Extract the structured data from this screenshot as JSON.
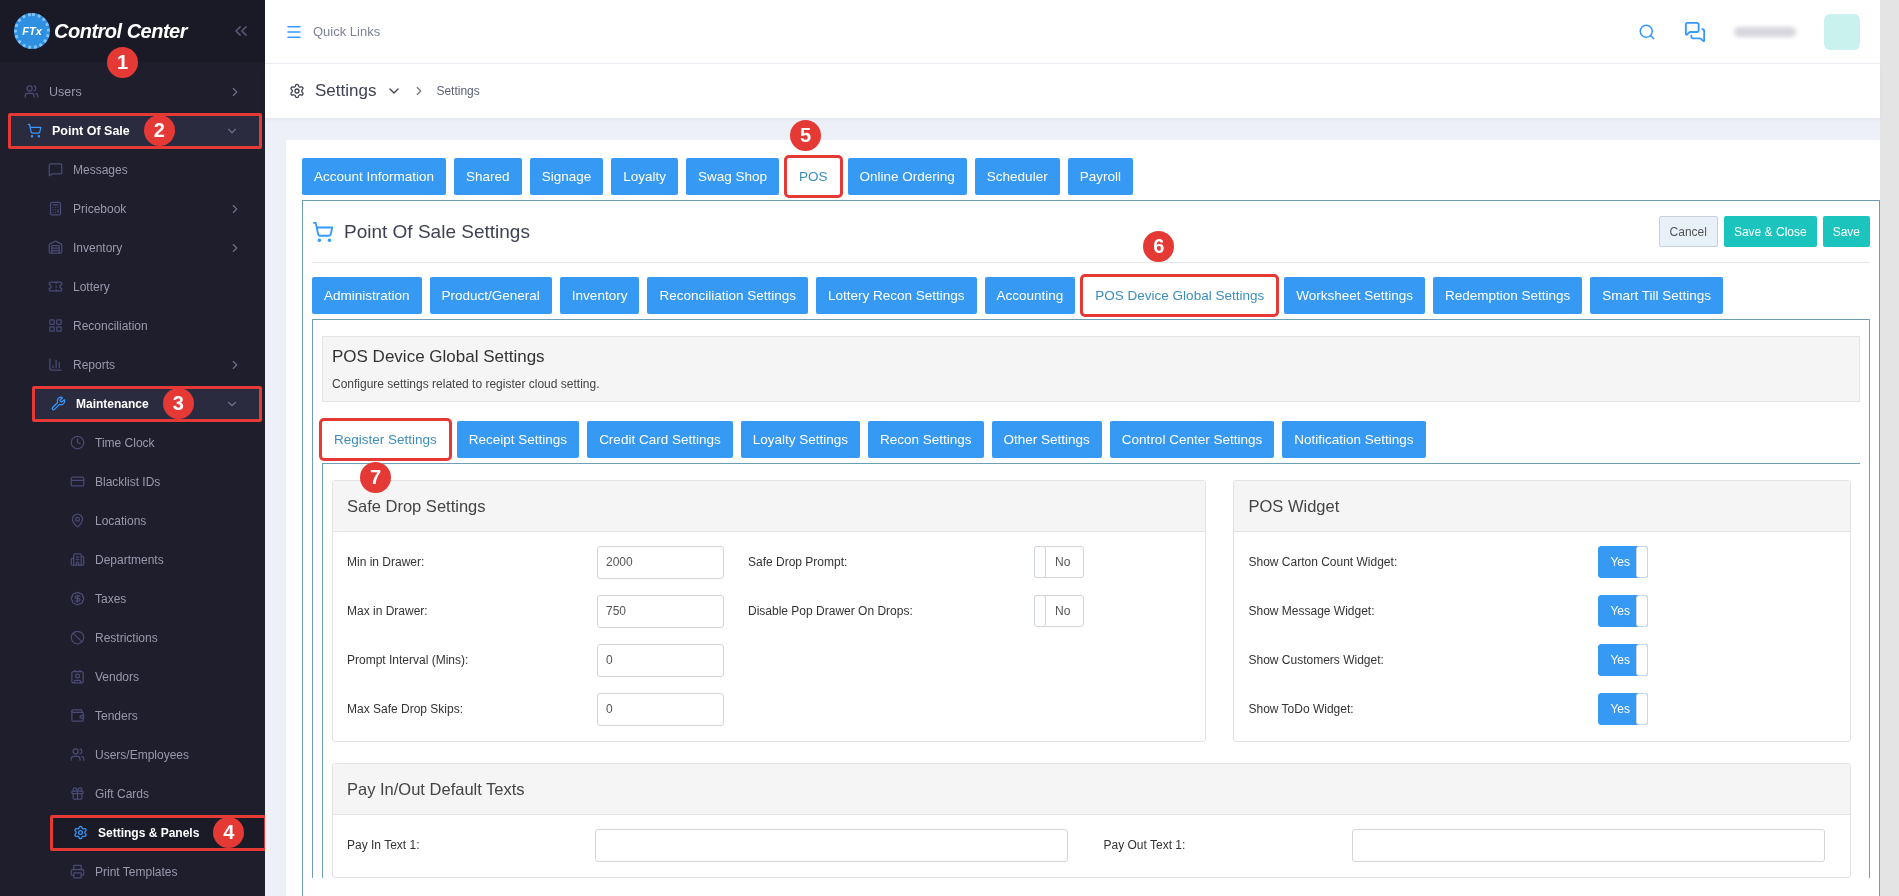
{
  "sidebar": {
    "logo_badge": "FTx",
    "logo_text": "Control Center",
    "logo_callout": {
      "number": "1"
    },
    "items": [
      {
        "label": "Users",
        "selected": false,
        "expanded": false
      },
      {
        "label": "Point Of Sale",
        "selected": true,
        "expanded": true,
        "callout": {
          "number": "2"
        },
        "children": [
          {
            "label": "Messages",
            "selected": false
          },
          {
            "label": "Pricebook",
            "selected": false,
            "expanded": false
          },
          {
            "label": "Inventory",
            "selected": false,
            "expanded": false
          },
          {
            "label": "Lottery",
            "selected": false
          },
          {
            "label": "Reconciliation",
            "selected": false
          },
          {
            "label": "Reports",
            "selected": false,
            "expanded": false
          },
          {
            "label": "Maintenance",
            "selected": true,
            "expanded": true,
            "callout": {
              "number": "3"
            },
            "children": [
              {
                "label": "Time Clock",
                "selected": false
              },
              {
                "label": "Blacklist IDs",
                "selected": false
              },
              {
                "label": "Locations",
                "selected": false
              },
              {
                "label": "Departments",
                "selected": false
              },
              {
                "label": "Taxes",
                "selected": false
              },
              {
                "label": "Restrictions",
                "selected": false
              },
              {
                "label": "Vendors",
                "selected": false
              },
              {
                "label": "Tenders",
                "selected": false
              },
              {
                "label": "Users/Employees",
                "selected": false
              },
              {
                "label": "Gift Cards",
                "selected": false
              },
              {
                "label": "Settings & Panels",
                "selected": true,
                "callout": {
                  "number": "4"
                }
              },
              {
                "label": "Print Templates",
                "selected": false
              }
            ]
          }
        ]
      }
    ]
  },
  "topbar": {
    "quick_links": "Quick Links"
  },
  "breadcrumb": {
    "title": "Settings",
    "current": "Settings"
  },
  "top_tabs": [
    {
      "label": "Account Information",
      "selected": false
    },
    {
      "label": "Shared",
      "selected": false
    },
    {
      "label": "Signage",
      "selected": false
    },
    {
      "label": "Loyalty",
      "selected": false
    },
    {
      "label": "Swag Shop",
      "selected": false
    },
    {
      "label": "POS",
      "selected": true,
      "callout": {
        "number": "5"
      }
    },
    {
      "label": "Online Ordering",
      "selected": false
    },
    {
      "label": "Scheduler",
      "selected": false
    },
    {
      "label": "Payroll",
      "selected": false
    }
  ],
  "panel": {
    "title": "Point Of Sale Settings",
    "buttons": [
      {
        "label": "Cancel",
        "kind": "secondary"
      },
      {
        "label": "Save & Close",
        "kind": "primary"
      },
      {
        "label": "Save",
        "kind": "primary"
      }
    ],
    "tabs": [
      {
        "label": "Administration",
        "selected": false
      },
      {
        "label": "Product/General",
        "selected": false
      },
      {
        "label": "Inventory",
        "selected": false
      },
      {
        "label": "Reconciliation Settings",
        "selected": false
      },
      {
        "label": "Lottery Recon Settings",
        "selected": false
      },
      {
        "label": "Accounting",
        "selected": false
      },
      {
        "label": "POS Device Global Settings",
        "selected": true,
        "callout": {
          "number": "6"
        }
      },
      {
        "label": "Worksheet Settings",
        "selected": false
      },
      {
        "label": "Redemption Settings",
        "selected": false
      },
      {
        "label": "Smart Till Settings",
        "selected": false
      }
    ],
    "section": {
      "title": "POS Device Global Settings",
      "description": "Configure settings related to register cloud setting.",
      "tabs": [
        {
          "label": "Register Settings",
          "selected": true,
          "callout": {
            "number": "7"
          }
        },
        {
          "label": "Receipt Settings",
          "selected": false
        },
        {
          "label": "Credit Card Settings",
          "selected": false
        },
        {
          "label": "Loyalty Settings",
          "selected": false
        },
        {
          "label": "Recon Settings",
          "selected": false
        },
        {
          "label": "Other Settings",
          "selected": false
        },
        {
          "label": "Control Center Settings",
          "selected": false
        },
        {
          "label": "Notification Settings",
          "selected": false
        }
      ],
      "cards": [
        {
          "kind": "split",
          "title": "Safe Drop Settings",
          "fields": [
            {
              "label": "Min in Drawer:",
              "value": "2000"
            },
            {
              "label": "Max in Drawer:",
              "value": "750"
            },
            {
              "label": "Prompt Interval (Mins):",
              "value": "0"
            },
            {
              "label": "Max Safe Drop Skips:",
              "value": "0"
            }
          ],
          "toggles": [
            {
              "label": "Safe Drop Prompt:",
              "on": false,
              "text": "No"
            },
            {
              "label": "Disable Pop Drawer On Drops:",
              "on": false,
              "text": "No"
            }
          ]
        },
        {
          "kind": "toggles",
          "title": "POS Widget",
          "toggles": [
            {
              "label": "Show Carton Count Widget:",
              "on": true,
              "text": "Yes"
            },
            {
              "label": "Show Message Widget:",
              "on": true,
              "text": "Yes"
            },
            {
              "label": "Show Customers Widget:",
              "on": true,
              "text": "Yes"
            },
            {
              "label": "Show ToDo Widget:",
              "on": true,
              "text": "Yes"
            }
          ]
        },
        {
          "kind": "pairs",
          "title": "Pay In/Out Default Texts",
          "fields": [
            {
              "label": "Pay In Text 1:"
            },
            {
              "label": "Pay Out Text 1:"
            }
          ]
        }
      ]
    }
  }
}
